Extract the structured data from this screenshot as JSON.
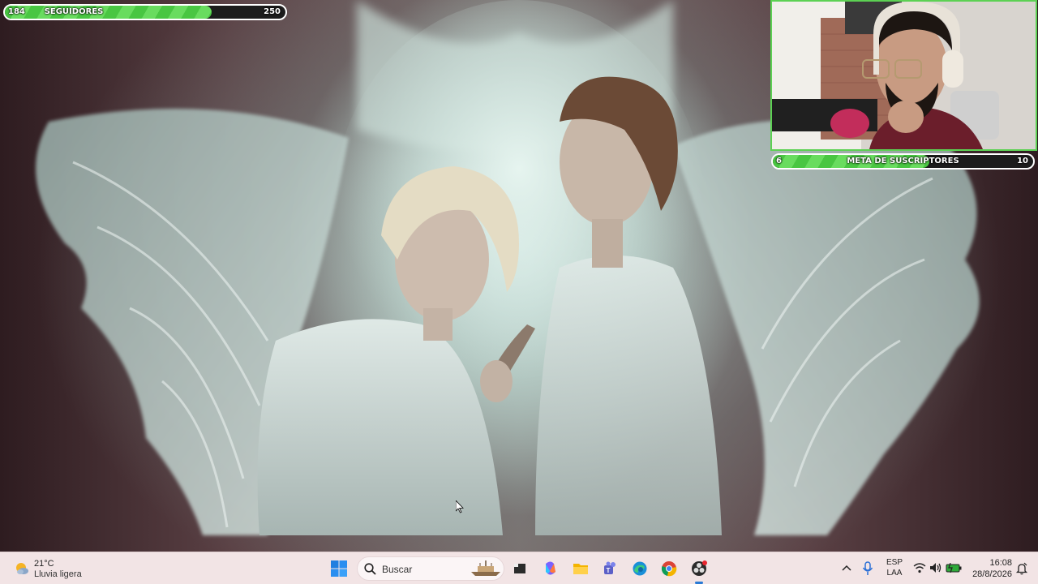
{
  "overlay": {
    "followers_goal": {
      "current": "184",
      "label": "SEGUIDORES",
      "target": "250",
      "progress": 0.736
    },
    "subscribers_goal": {
      "current": "6",
      "label": "META DE SUSCRIPTORES",
      "target": "10",
      "progress": 0.6
    }
  },
  "taskbar": {
    "weather": {
      "temperature": "21°C",
      "condition": "Lluvia ligera",
      "icon": "weather-sun-cloud-icon"
    },
    "search": {
      "placeholder": "Buscar"
    },
    "apps": [
      {
        "name": "file-manager-icon",
        "active": false
      },
      {
        "name": "copilot-icon",
        "active": false
      },
      {
        "name": "file-explorer-icon",
        "active": false
      },
      {
        "name": "teams-icon",
        "active": false
      },
      {
        "name": "edge-icon",
        "active": false
      },
      {
        "name": "chrome-icon",
        "active": false
      },
      {
        "name": "obs-icon",
        "active": true
      }
    ],
    "language": {
      "line1": "ESP",
      "line2": "LAA"
    },
    "clock": {
      "time": "16:08",
      "date": "28/8/2026"
    }
  },
  "colors": {
    "goal_fill": "#49c642",
    "webcam_border": "#5cd153",
    "taskbar_bg": "#f2e4e5"
  }
}
